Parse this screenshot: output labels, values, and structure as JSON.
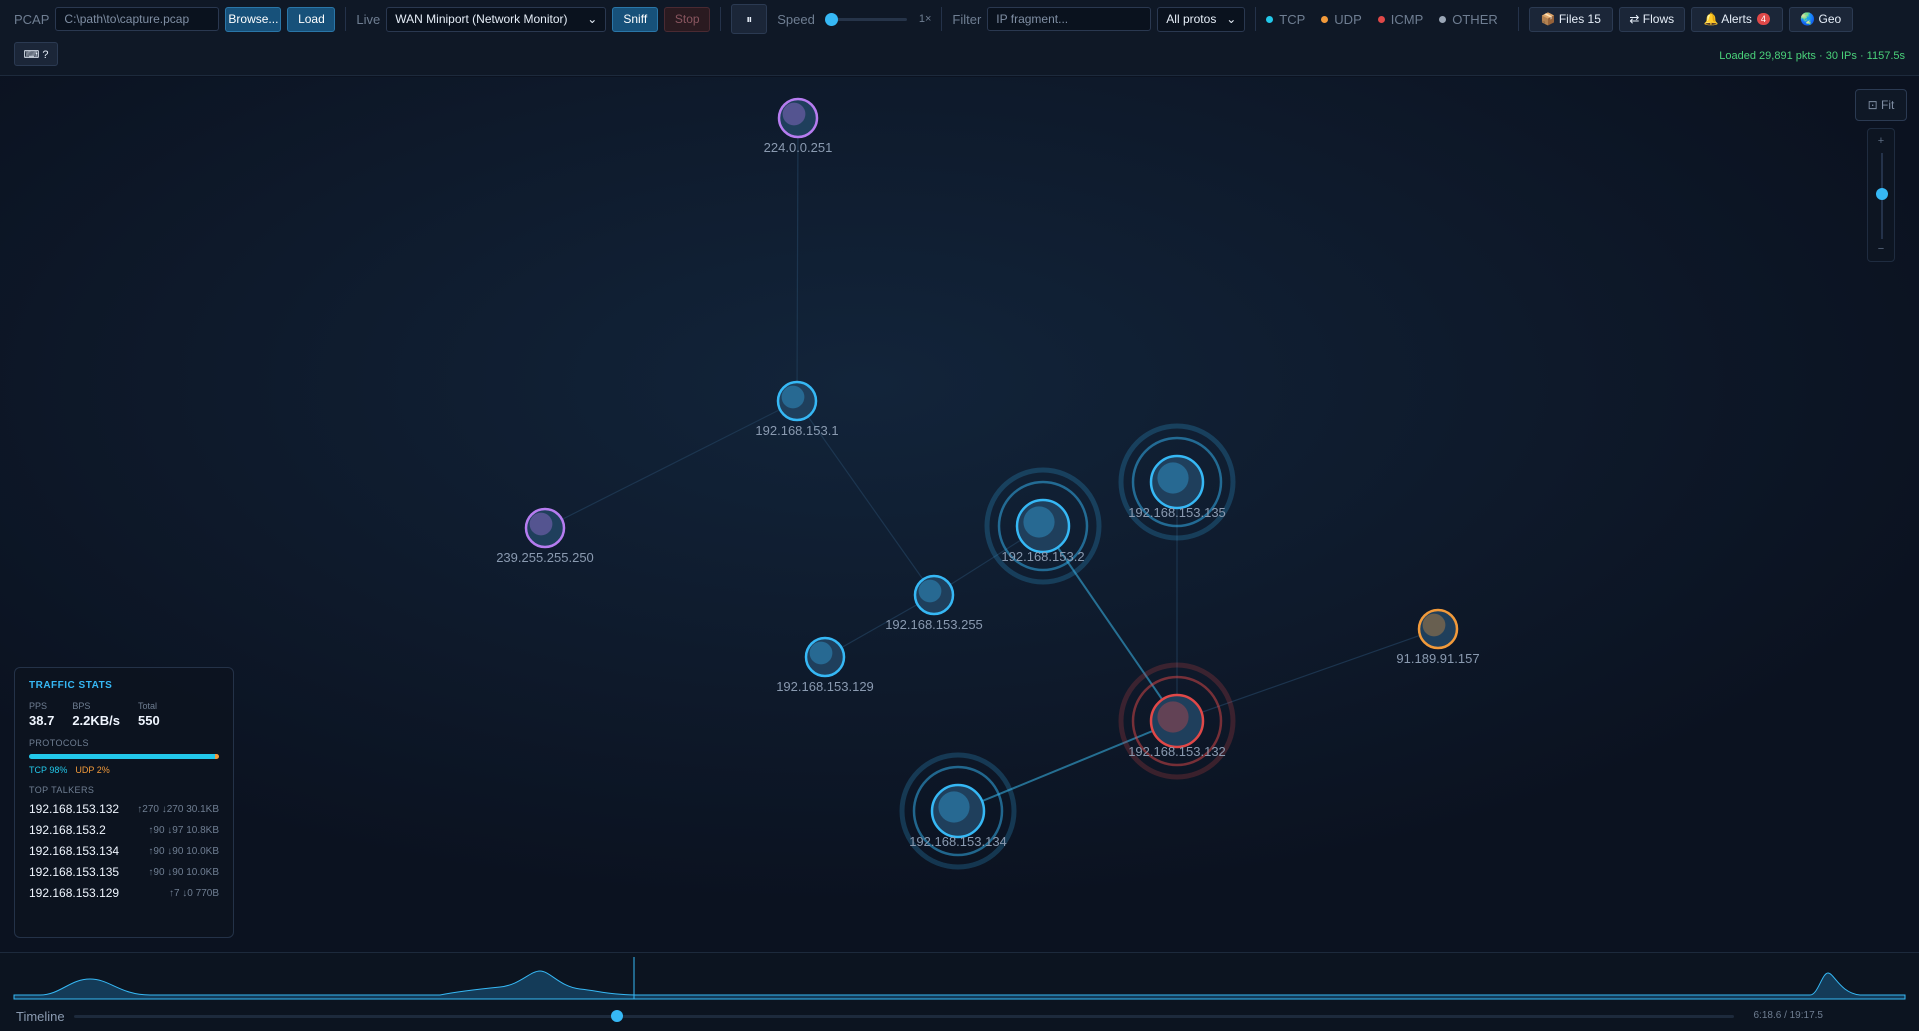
{
  "toolbar": {
    "pcap_label": "PCAP",
    "pcap_placeholder": "C:\\path\\to\\capture.pcap",
    "browse_label": "Browse...",
    "load_label": "Load",
    "live_label": "Live",
    "interface_selected": "WAN Miniport (Network Monitor)",
    "sniff_label": "Sniff",
    "stop_label": "Stop",
    "pause_glyph": "⏸",
    "speed_label": "Speed",
    "speed_value": "1×",
    "filter_label": "Filter",
    "filter_placeholder": "IP fragment...",
    "proto_selected": "All protos",
    "protocols": [
      {
        "name": "TCP",
        "color": "#22c8ea"
      },
      {
        "name": "UDP",
        "color": "#f29a3a"
      },
      {
        "name": "ICMP",
        "color": "#e04848"
      },
      {
        "name": "OTHER",
        "color": "#9aa6b6"
      }
    ],
    "files_label": "📦 Files",
    "files_count": "15",
    "flows_label": "⇄ Flows",
    "alerts_label": "🔔 Alerts",
    "alerts_count": "4",
    "geo_label": "🌏 Geo",
    "shortcut_label": "⌨ ?",
    "status": "Loaded 29,891 pkts · 30 IPs · 1157.5s"
  },
  "zoom": {
    "fit_label": "⊡ Fit",
    "plus": "+",
    "minus": "−"
  },
  "graph": {
    "nodes": [
      {
        "id": "224.0.0.251",
        "label": "224.0.0.251",
        "type": "multicast",
        "rings": 0
      },
      {
        "id": "192.168.153.1",
        "label": "192.168.153.1",
        "type": "local",
        "rings": 0
      },
      {
        "id": "239.255.255.250",
        "label": "239.255.255.250",
        "type": "multicast",
        "rings": 0
      },
      {
        "id": "192.168.153.2",
        "label": "192.168.153.2",
        "type": "local",
        "rings": 2
      },
      {
        "id": "192.168.153.135",
        "label": "192.168.153.135",
        "type": "local",
        "rings": 2
      },
      {
        "id": "192.168.153.255",
        "label": "192.168.153.255",
        "type": "local",
        "rings": 0
      },
      {
        "id": "192.168.153.129",
        "label": "192.168.153.129",
        "type": "local",
        "rings": 0
      },
      {
        "id": "91.189.91.157",
        "label": "91.189.91.157",
        "type": "external",
        "rings": 0
      },
      {
        "id": "192.168.153.132",
        "label": "192.168.153.132",
        "type": "alert",
        "rings": 2
      },
      {
        "id": "192.168.153.134",
        "label": "192.168.153.134",
        "type": "local",
        "rings": 2
      }
    ],
    "edges": [
      [
        "224.0.0.251",
        "192.168.153.1"
      ],
      [
        "192.168.153.1",
        "239.255.255.250"
      ],
      [
        "192.168.153.1",
        "192.168.153.255"
      ],
      [
        "192.168.153.2",
        "192.168.153.255"
      ],
      [
        "192.168.153.129",
        "192.168.153.255"
      ],
      [
        "192.168.153.2",
        "192.168.153.132"
      ],
      [
        "192.168.153.135",
        "192.168.153.132"
      ],
      [
        "192.168.153.132",
        "91.189.91.157"
      ],
      [
        "192.168.153.132",
        "192.168.153.134"
      ]
    ],
    "colors": {
      "local": "#36b8f5",
      "multicast": "#b67cf0",
      "external": "#f29a3a",
      "alert": "#e04848"
    }
  },
  "stats": {
    "title": "TRAFFIC STATS",
    "pps_label": "PPS",
    "pps": "38.7",
    "bps_label": "BPS",
    "bps": "2.2KB/s",
    "total_label": "Total",
    "total": "550",
    "protocols_label": "PROTOCOLS",
    "tcp_pct": 98,
    "udp_pct": 2,
    "tcp_text": "TCP 98%",
    "udp_text": "UDP 2%",
    "top_label": "TOP TALKERS",
    "talkers": [
      {
        "ip": "192.168.153.132",
        "traffic": "↑270 ↓270 30.1KB"
      },
      {
        "ip": "192.168.153.2",
        "traffic": "↑90 ↓97 10.8KB"
      },
      {
        "ip": "192.168.153.134",
        "traffic": "↑90 ↓90 10.0KB"
      },
      {
        "ip": "192.168.153.135",
        "traffic": "↑90 ↓90 10.0KB"
      },
      {
        "ip": "192.168.153.129",
        "traffic": "↑7 ↓0 770B"
      }
    ]
  },
  "timeline": {
    "label": "Timeline",
    "time": "6:18.6 / 19:17.5",
    "position": 0.327
  }
}
